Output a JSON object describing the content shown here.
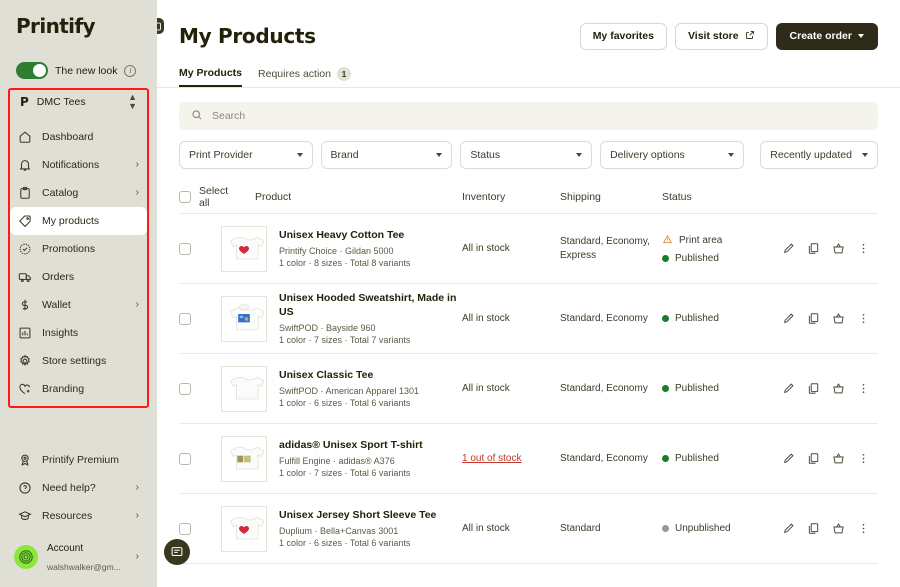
{
  "sidebar": {
    "brand": "Printify",
    "new_look": {
      "label": "The new look",
      "enabled": true,
      "info_icon": "info-icon"
    },
    "store": {
      "name": "DMC Tees",
      "glyph": "P"
    },
    "items": [
      {
        "label": "Dashboard",
        "icon": "home-icon",
        "chevron": false,
        "active": false
      },
      {
        "label": "Notifications",
        "icon": "bell-icon",
        "chevron": true,
        "active": false
      },
      {
        "label": "Catalog",
        "icon": "clipboard-icon",
        "chevron": true,
        "active": false
      },
      {
        "label": "My products",
        "icon": "tag-icon",
        "chevron": false,
        "active": true
      },
      {
        "label": "Promotions",
        "icon": "badge-check-icon",
        "chevron": false,
        "active": false
      },
      {
        "label": "Orders",
        "icon": "truck-icon",
        "chevron": false,
        "active": false
      },
      {
        "label": "Wallet",
        "icon": "dollar-icon",
        "chevron": true,
        "active": false
      },
      {
        "label": "Insights",
        "icon": "chart-icon",
        "chevron": false,
        "active": false
      },
      {
        "label": "Store settings",
        "icon": "gear-icon",
        "chevron": false,
        "active": false
      },
      {
        "label": "Branding",
        "icon": "heart-plus-icon",
        "chevron": false,
        "active": false
      }
    ],
    "bottom_items": [
      {
        "label": "Printify Premium",
        "icon": "medal-icon",
        "chevron": false
      },
      {
        "label": "Need help?",
        "icon": "question-circle-icon",
        "chevron": true
      },
      {
        "label": "Resources",
        "icon": "graduation-cap-icon",
        "chevron": true
      }
    ],
    "account": {
      "name": "Account",
      "email": "walshwalker@gm...",
      "chevron": ">"
    }
  },
  "header": {
    "title": "My Products",
    "buttons": [
      {
        "label": "My favorites",
        "style": "outline",
        "icon": null
      },
      {
        "label": "Visit store",
        "style": "outline",
        "icon": "external-link-icon"
      },
      {
        "label": "Create order",
        "style": "dark",
        "icon": "chevron-down-icon"
      }
    ],
    "collapse_icon": "sidebar-collapse-icon"
  },
  "tabs": [
    {
      "label": "My Products",
      "active": true,
      "count": null
    },
    {
      "label": "Requires action",
      "active": false,
      "count": "1"
    }
  ],
  "search": {
    "placeholder": "Search",
    "value": "",
    "icon": "search-icon"
  },
  "filters": [
    {
      "label": "Print Provider",
      "name": "print-provider"
    },
    {
      "label": "Brand",
      "name": "brand"
    },
    {
      "label": "Status",
      "name": "status"
    },
    {
      "label": "Delivery options",
      "name": "delivery-options"
    },
    {
      "label": "Recently updated",
      "name": "sort-order"
    }
  ],
  "table": {
    "select_all_label": "Select all",
    "columns": {
      "product": "Product",
      "inventory": "Inventory",
      "shipping": "Shipping",
      "status": "Status"
    },
    "rows": [
      {
        "title": "Unisex Heavy Cotton Tee",
        "provider": "Printify Choice · Gildan 5000",
        "variants": "1 color · 8 sizes · Total 8 variants",
        "inventory": "All in stock",
        "inventory_alert": false,
        "shipping": "Standard, Economy, Express",
        "statuses": [
          {
            "text": "Print area",
            "type": "warning"
          },
          {
            "text": "Published",
            "type": "published"
          }
        ],
        "thumb": "tshirt-heart"
      },
      {
        "title": "Unisex Hooded Sweatshirt, Made in US",
        "provider": "SwiftPOD · Bayside 960",
        "variants": "1 color · 7 sizes · Total 7 variants",
        "inventory": "All in stock",
        "inventory_alert": false,
        "shipping": "Standard, Economy",
        "statuses": [
          {
            "text": "Published",
            "type": "published"
          }
        ],
        "thumb": "hoodie-blue"
      },
      {
        "title": "Unisex Classic Tee",
        "provider": "SwiftPOD · American Apparel 1301",
        "variants": "1 color · 6 sizes · Total 6 variants",
        "inventory": "All in stock",
        "inventory_alert": false,
        "shipping": "Standard, Economy",
        "statuses": [
          {
            "text": "Published",
            "type": "published"
          }
        ],
        "thumb": "tshirt-plain"
      },
      {
        "title": "adidas® Unisex Sport T-shirt",
        "provider": "Fulfill Engine · adidas® A376",
        "variants": "1 color · 7 sizes · Total 6 variants",
        "inventory": "1 out of stock",
        "inventory_alert": true,
        "shipping": "Standard, Economy",
        "statuses": [
          {
            "text": "Published",
            "type": "published"
          }
        ],
        "thumb": "tshirt-art"
      },
      {
        "title": "Unisex Jersey Short Sleeve Tee",
        "provider": "Duplium · Bella+Canvas 3001",
        "variants": "1 color · 6 sizes · Total 6 variants",
        "inventory": "All in stock",
        "inventory_alert": false,
        "shipping": "Standard",
        "statuses": [
          {
            "text": "Unpublished",
            "type": "unpublished"
          }
        ],
        "thumb": "tshirt-heart"
      }
    ],
    "row_actions": [
      "edit-icon",
      "duplicate-icon",
      "add-to-cart-icon",
      "more-options-icon"
    ]
  },
  "chat": {
    "icon": "chat-bubble-icon"
  },
  "colors": {
    "sidebar_bg": "#dfdfd6",
    "accent_dark": "#2e2c18",
    "published_green": "#167d2d",
    "unpublished_grey": "#9b998a",
    "warning_orange": "#e08a3c",
    "error_red": "#c0392b",
    "highlight_box": "#ff1a1a",
    "avatar_green": "#8de63c"
  }
}
